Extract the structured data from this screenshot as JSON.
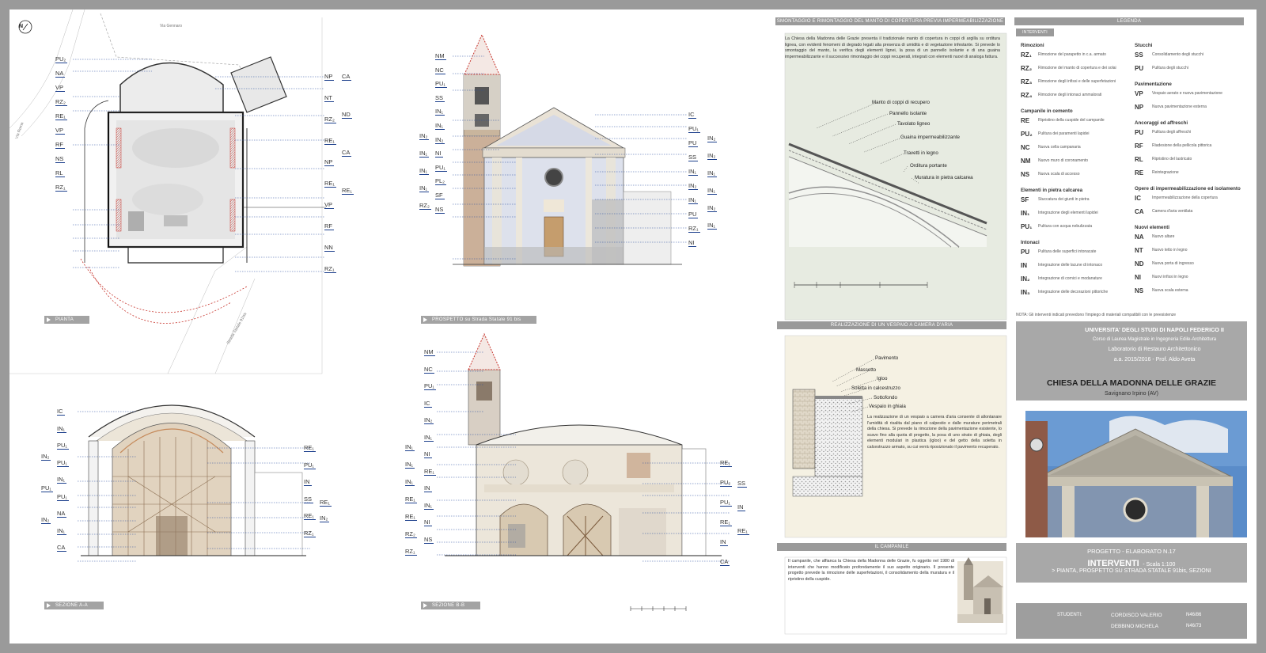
{
  "colors": {
    "frame": "#9a9a9a",
    "panelGreen": "#e7ebe1",
    "panelBeige": "#f5f1e3",
    "blueTag": "#1c3f8c",
    "redHatch": "#c8362e"
  },
  "sections": {
    "pianta": "PIANTA",
    "prospetto": "PROSPETTO su Strada Statale 91 bis",
    "sezione_a": "SEZIONE A-A",
    "sezione_b": "SEZIONE B-B"
  },
  "plan_texts": {
    "north": "N",
    "road1": "Via Roma",
    "road2": "Strada Statale 91bis",
    "street_top": "Via Gennaro"
  },
  "left_codes": {
    "plan_left": [
      "PU₂",
      "NA",
      "VP",
      "RZ₂",
      "RE₁",
      "VP",
      "RF",
      "NS",
      "RL",
      "RZ₁"
    ],
    "plan_right_a": [
      "NP",
      "NT",
      "RZ₂",
      "RE₁",
      "NP",
      "RE₁",
      "VP",
      "RF",
      "NN",
      "RZ₁"
    ],
    "plan_right_b": [
      "CA",
      "ND",
      "CA",
      "RE₁"
    ],
    "prosp_left": [
      "NM",
      "NC",
      "PU₁",
      "SS",
      "IN₁",
      "IN₁",
      "IN₂",
      "NI",
      "PU₁",
      "PL₂",
      "SF",
      "NS"
    ],
    "prosp_left_b": [
      "IN₂",
      "IN₁",
      "IN₁",
      "IN₁",
      "RZ₂"
    ],
    "prosp_right": [
      "IC",
      "PU₁",
      "PU",
      "SS",
      "IN₁",
      "IN₂",
      "IN₁",
      "PU",
      "RZ₁",
      "NI"
    ],
    "prosp_right_b": [
      "IN₂",
      "IN₂",
      "IN₁",
      "IN₁",
      "IN₂",
      "IN₁"
    ],
    "sez_a_left": [
      "IC",
      "IN₁",
      "PU₁",
      "PU₁",
      "IN₁",
      "PU₁",
      "NA",
      "IN₁",
      "CA"
    ],
    "sez_a_left_b": [
      "IN₂",
      "PU₁",
      "IN₂"
    ],
    "sez_a_right": [
      "RE₁",
      "PU₁",
      "IN",
      "SS",
      "RE₁",
      "RZ₁"
    ],
    "sez_a_right_b": [
      "RE₁",
      "IN₂"
    ],
    "sez_b_left": [
      "NM",
      "NC",
      "PU₁",
      "IC",
      "IN₂",
      "IN₁",
      "NI",
      "RE₁",
      "IN",
      "IN₁",
      "NI",
      "NS"
    ],
    "sez_b_left_b": [
      "IN₁",
      "IN₁",
      "IN₁",
      "RE₁",
      "RE₁",
      "RZ₂",
      "RZ₁"
    ],
    "sez_b_right": [
      "RE₁",
      "PU₂",
      "PU₁",
      "RE₁",
      "IN",
      "CA"
    ],
    "sez_b_right_b": [
      "SS",
      "IN",
      "RE₁"
    ]
  },
  "panel1": {
    "title": "SMONTAGGIO E RIMONTAGGIO DEL MANTO DI COPERTURA PREVIA IMPERMEABILIZZAZIONE",
    "text": "La Chiesa della Madonna delle Grazie presenta il tradizionale manto di copertura in coppi di argilla su orditura lignea, con evidenti fenomeni di degrado legati alla presenza di umidità e di vegetazione infestante. Si prevede lo smontaggio del manto, la verifica degli elementi lignei, la posa di un pannello isolante e di una guaina impermeabilizzante e il successivo rimontaggio dei coppi recuperati, integrati con elementi nuovi di analoga fattura.",
    "labels": [
      "Manto di coppi di recupero",
      "Pannello isolante",
      "Tavolato ligneo",
      "Guaina impermeabilizzante",
      "Travetti in legno",
      "Orditura portante",
      "Muratura in pietra calcarea"
    ]
  },
  "panel2": {
    "title": "REALIZZAZIONE DI UN VESPAIO A CAMERA D'ARIA",
    "labels": [
      "Pavimento",
      "Massetto",
      "Igloo",
      "Soletta in calcestruzzo",
      "Sottofondo",
      "Vespaio in ghiaia"
    ],
    "text": "La realizzazione di un vespaio a camera d'aria consente di allontanare l'umidità di risalita dal piano di calpestio e dalle murature perimetrali della chiesa. Si prevede la rimozione della pavimentazione esistente, lo scavo fino alla quota di progetto, la posa di uno strato di ghiaia, degli elementi modulari in plastica (igloo) e del getto della soletta in calcestruzzo armato, su cui verrà riposizionato il pavimento recuperato."
  },
  "panel3": {
    "title": "IL CAMPANILE",
    "text": "Il campanile, che affianca la Chiesa della Madonna delle Grazie, fu oggetto nel 1980 di interventi che hanno modificato profondamente il suo aspetto originario. Il presente progetto prevede la rimozione delle superfetazioni, il consolidamento della muratura e il ripristino della cuspide."
  },
  "legend": {
    "title": "LEGENDA",
    "sub": "INTERVENTI",
    "col1": [
      {
        "group": "Rimozioni",
        "items": [
          {
            "code": "RZ₁",
            "txt": "Rimozione del parapetto in c.a. armato"
          },
          {
            "code": "RZ₂",
            "txt": "Rimozione del manto di copertura e dei solai"
          },
          {
            "code": "RZ₃",
            "txt": "Rimozione degli infissi e delle superfetazioni"
          },
          {
            "code": "RZ₄",
            "txt": "Rimozione degli intonaci ammalorati"
          }
        ]
      },
      {
        "group": "Campanile in cemento",
        "items": [
          {
            "code": "RE",
            "txt": "Ripristino della cuspide del campanile"
          },
          {
            "code": "PU₂",
            "txt": "Pulitura dei paramenti lapidei"
          },
          {
            "code": "NC",
            "txt": "Nuova cella campanaria"
          },
          {
            "code": "NM",
            "txt": "Nuovo muro di coronamento"
          },
          {
            "code": "NS",
            "txt": "Nuova scala di accesso"
          }
        ]
      },
      {
        "group": "Elementi in pietra calcarea",
        "items": [
          {
            "code": "SF",
            "txt": "Stuccatura dei giunti in pietra"
          },
          {
            "code": "IN₁",
            "txt": "Integrazione degli elementi lapidei"
          },
          {
            "code": "PU₁",
            "txt": "Pulitura con acqua nebulizzata"
          }
        ]
      },
      {
        "group": "Intonaci",
        "items": [
          {
            "code": "PU",
            "txt": "Pulitura delle superfici intonacate"
          },
          {
            "code": "IN",
            "txt": "Integrazione delle lacune di intonaco"
          },
          {
            "code": "IN₂",
            "txt": "Integrazione di cornici e modanature"
          },
          {
            "code": "IN₃",
            "txt": "Integrazione delle decorazioni pittoriche"
          }
        ]
      }
    ],
    "col2": [
      {
        "group": "Stucchi",
        "items": [
          {
            "code": "SS",
            "txt": "Consolidamento degli stucchi"
          },
          {
            "code": "PU",
            "txt": "Pulitura degli stucchi"
          }
        ]
      },
      {
        "group": "Pavimentazione",
        "items": [
          {
            "code": "VP",
            "txt": "Vespaio aerato e nuova pavimentazione"
          },
          {
            "code": "NP",
            "txt": "Nuova pavimentazione esterna"
          }
        ]
      },
      {
        "group": "Ancoraggi ed affreschi",
        "items": [
          {
            "code": "PU",
            "txt": "Pulitura degli affreschi"
          },
          {
            "code": "RF",
            "txt": "Riadesione della pellicola pittorica"
          },
          {
            "code": "RL",
            "txt": "Ripristino del lastricato"
          },
          {
            "code": "RE",
            "txt": "Reintegrazione"
          }
        ]
      },
      {
        "group": "Opere di impermeabilizzazione ed isolamento",
        "items": [
          {
            "code": "IC",
            "txt": "Impermeabilizzazione della copertura"
          },
          {
            "code": "CA",
            "txt": "Camera d'aria ventilata"
          }
        ]
      },
      {
        "group": "Nuovi elementi",
        "items": [
          {
            "code": "NA",
            "txt": "Nuovo altare"
          },
          {
            "code": "NT",
            "txt": "Nuovo tetto in legno"
          },
          {
            "code": "ND",
            "txt": "Nuova porta di ingresso"
          },
          {
            "code": "NI",
            "txt": "Nuovi infissi in legno"
          },
          {
            "code": "NS",
            "txt": "Nuova scala esterna"
          }
        ]
      }
    ],
    "note": "NOTA: Gli interventi indicati prevedono l'impiego di materiali compatibili con le preesistenze"
  },
  "university": {
    "line1": "UNIVERSITA' DEGLI STUDI DI NAPOLI FEDERICO II",
    "line2": "Corso di Laurea Magistrale in Ingegneria Edile-Architettura",
    "line3": "Laboratorio di Restauro Architettonico",
    "line4": "a.a. 2015/2016 - Prof. Aldo Aveta"
  },
  "church": {
    "name": "CHIESA DELLA MADONNA DELLE GRAZIE",
    "place": "Savignano Irpino (AV)"
  },
  "project": {
    "line1": "PROGETTO - ELABORATO N.17",
    "line2": "INTERVENTI",
    "scale": "- Scala 1:100",
    "line3": "> PIANTA, PROSPETTO SU STRADA STATALE 91bis, SEZIONI"
  },
  "students": {
    "label": "STUDENTI:",
    "s1": "CORDISCO VALERIO",
    "m1": "N46/86",
    "s2": "DEBBINO MICHELA",
    "m2": "N46/73"
  }
}
